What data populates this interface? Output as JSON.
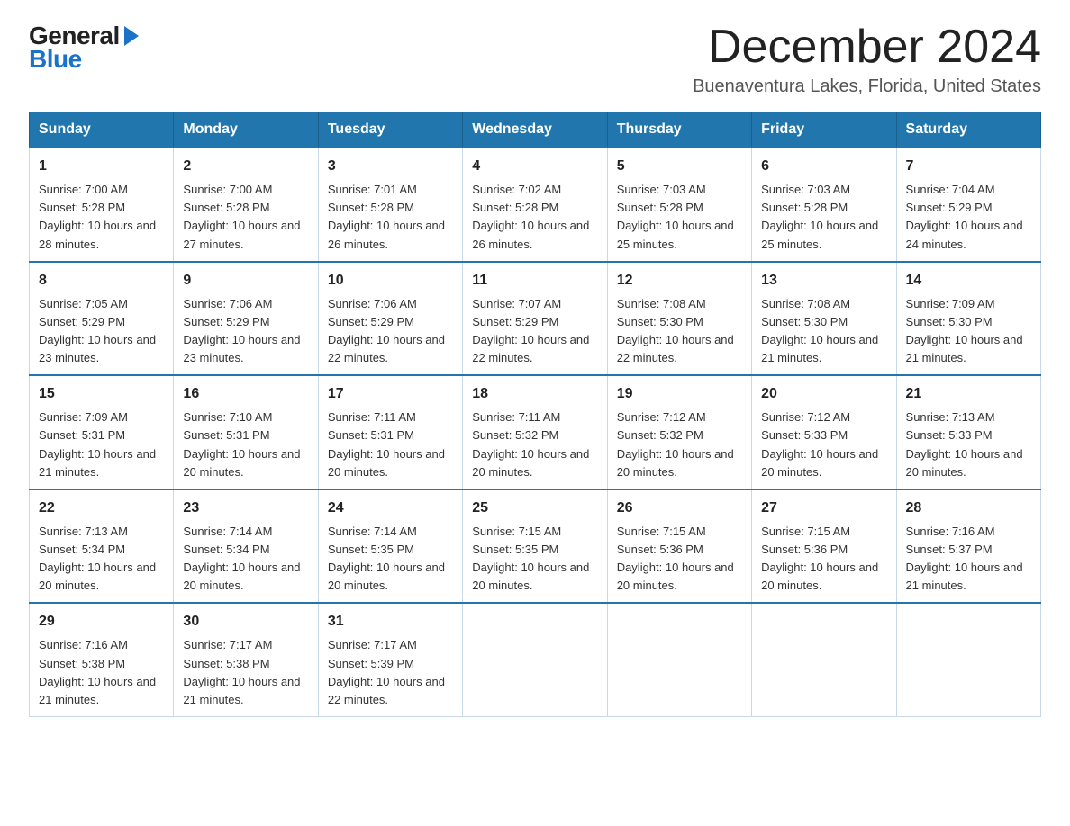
{
  "logo": {
    "text_general": "General",
    "arrow": "▶",
    "text_blue": "Blue"
  },
  "header": {
    "month_year": "December 2024",
    "location": "Buenaventura Lakes, Florida, United States"
  },
  "days_of_week": [
    "Sunday",
    "Monday",
    "Tuesday",
    "Wednesday",
    "Thursday",
    "Friday",
    "Saturday"
  ],
  "weeks": [
    [
      {
        "day": "1",
        "sunrise": "7:00 AM",
        "sunset": "5:28 PM",
        "daylight": "10 hours and 28 minutes."
      },
      {
        "day": "2",
        "sunrise": "7:00 AM",
        "sunset": "5:28 PM",
        "daylight": "10 hours and 27 minutes."
      },
      {
        "day": "3",
        "sunrise": "7:01 AM",
        "sunset": "5:28 PM",
        "daylight": "10 hours and 26 minutes."
      },
      {
        "day": "4",
        "sunrise": "7:02 AM",
        "sunset": "5:28 PM",
        "daylight": "10 hours and 26 minutes."
      },
      {
        "day": "5",
        "sunrise": "7:03 AM",
        "sunset": "5:28 PM",
        "daylight": "10 hours and 25 minutes."
      },
      {
        "day": "6",
        "sunrise": "7:03 AM",
        "sunset": "5:28 PM",
        "daylight": "10 hours and 25 minutes."
      },
      {
        "day": "7",
        "sunrise": "7:04 AM",
        "sunset": "5:29 PM",
        "daylight": "10 hours and 24 minutes."
      }
    ],
    [
      {
        "day": "8",
        "sunrise": "7:05 AM",
        "sunset": "5:29 PM",
        "daylight": "10 hours and 23 minutes."
      },
      {
        "day": "9",
        "sunrise": "7:06 AM",
        "sunset": "5:29 PM",
        "daylight": "10 hours and 23 minutes."
      },
      {
        "day": "10",
        "sunrise": "7:06 AM",
        "sunset": "5:29 PM",
        "daylight": "10 hours and 22 minutes."
      },
      {
        "day": "11",
        "sunrise": "7:07 AM",
        "sunset": "5:29 PM",
        "daylight": "10 hours and 22 minutes."
      },
      {
        "day": "12",
        "sunrise": "7:08 AM",
        "sunset": "5:30 PM",
        "daylight": "10 hours and 22 minutes."
      },
      {
        "day": "13",
        "sunrise": "7:08 AM",
        "sunset": "5:30 PM",
        "daylight": "10 hours and 21 minutes."
      },
      {
        "day": "14",
        "sunrise": "7:09 AM",
        "sunset": "5:30 PM",
        "daylight": "10 hours and 21 minutes."
      }
    ],
    [
      {
        "day": "15",
        "sunrise": "7:09 AM",
        "sunset": "5:31 PM",
        "daylight": "10 hours and 21 minutes."
      },
      {
        "day": "16",
        "sunrise": "7:10 AM",
        "sunset": "5:31 PM",
        "daylight": "10 hours and 20 minutes."
      },
      {
        "day": "17",
        "sunrise": "7:11 AM",
        "sunset": "5:31 PM",
        "daylight": "10 hours and 20 minutes."
      },
      {
        "day": "18",
        "sunrise": "7:11 AM",
        "sunset": "5:32 PM",
        "daylight": "10 hours and 20 minutes."
      },
      {
        "day": "19",
        "sunrise": "7:12 AM",
        "sunset": "5:32 PM",
        "daylight": "10 hours and 20 minutes."
      },
      {
        "day": "20",
        "sunrise": "7:12 AM",
        "sunset": "5:33 PM",
        "daylight": "10 hours and 20 minutes."
      },
      {
        "day": "21",
        "sunrise": "7:13 AM",
        "sunset": "5:33 PM",
        "daylight": "10 hours and 20 minutes."
      }
    ],
    [
      {
        "day": "22",
        "sunrise": "7:13 AM",
        "sunset": "5:34 PM",
        "daylight": "10 hours and 20 minutes."
      },
      {
        "day": "23",
        "sunrise": "7:14 AM",
        "sunset": "5:34 PM",
        "daylight": "10 hours and 20 minutes."
      },
      {
        "day": "24",
        "sunrise": "7:14 AM",
        "sunset": "5:35 PM",
        "daylight": "10 hours and 20 minutes."
      },
      {
        "day": "25",
        "sunrise": "7:15 AM",
        "sunset": "5:35 PM",
        "daylight": "10 hours and 20 minutes."
      },
      {
        "day": "26",
        "sunrise": "7:15 AM",
        "sunset": "5:36 PM",
        "daylight": "10 hours and 20 minutes."
      },
      {
        "day": "27",
        "sunrise": "7:15 AM",
        "sunset": "5:36 PM",
        "daylight": "10 hours and 20 minutes."
      },
      {
        "day": "28",
        "sunrise": "7:16 AM",
        "sunset": "5:37 PM",
        "daylight": "10 hours and 21 minutes."
      }
    ],
    [
      {
        "day": "29",
        "sunrise": "7:16 AM",
        "sunset": "5:38 PM",
        "daylight": "10 hours and 21 minutes."
      },
      {
        "day": "30",
        "sunrise": "7:17 AM",
        "sunset": "5:38 PM",
        "daylight": "10 hours and 21 minutes."
      },
      {
        "day": "31",
        "sunrise": "7:17 AM",
        "sunset": "5:39 PM",
        "daylight": "10 hours and 22 minutes."
      },
      null,
      null,
      null,
      null
    ]
  ]
}
